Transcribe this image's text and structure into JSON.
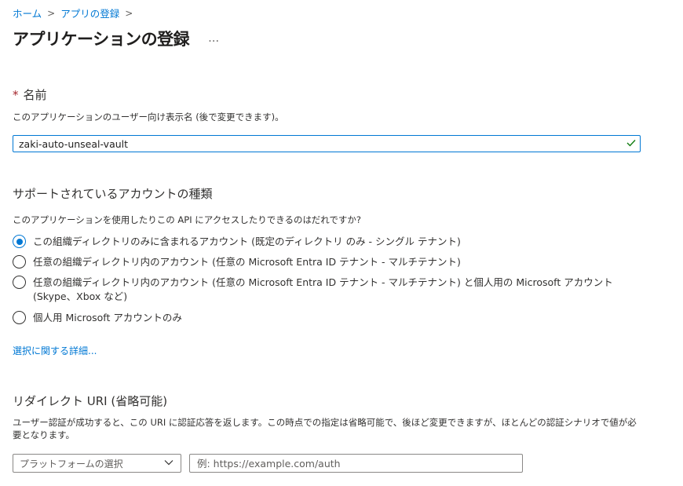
{
  "breadcrumb": {
    "home": "ホーム",
    "current": "アプリの登録",
    "separator": ">"
  },
  "page": {
    "title": "アプリケーションの登録",
    "more": "…"
  },
  "name_section": {
    "required_mark": "*",
    "label": "名前",
    "description": "このアプリケーションのユーザー向け表示名 (後で変更できます)。",
    "value": "zaki-auto-unseal-vault",
    "valid_icon": "checkmark-icon"
  },
  "account_types": {
    "heading": "サポートされているアカウントの種類",
    "question": "このアプリケーションを使用したりこの API にアクセスしたりできるのはだれですか?",
    "options": [
      {
        "label": "この組織ディレクトリのみに含まれるアカウント (既定のディレクトリ のみ - シングル テナント)",
        "selected": true
      },
      {
        "label": "任意の組織ディレクトリ内のアカウント (任意の Microsoft Entra ID テナント - マルチテナント)",
        "selected": false
      },
      {
        "label": "任意の組織ディレクトリ内のアカウント (任意の Microsoft Entra ID テナント - マルチテナント) と個人用の Microsoft アカウント (Skype、Xbox など)",
        "selected": false
      },
      {
        "label": "個人用 Microsoft アカウントのみ",
        "selected": false
      }
    ],
    "learn_more": "選択に関する詳細..."
  },
  "redirect": {
    "heading": "リダイレクト URI (省略可能)",
    "description": "ユーザー認証が成功すると、この URI に認証応答を返します。この時点での指定は省略可能で、後ほど変更できますが、ほとんどの認証シナリオで値が必要となります。",
    "platform_select": "プラットフォームの選択",
    "uri_placeholder": "例: https://example.com/auth"
  },
  "colors": {
    "accent": "#0078d4",
    "required": "#a4262c",
    "valid": "#107c10"
  }
}
